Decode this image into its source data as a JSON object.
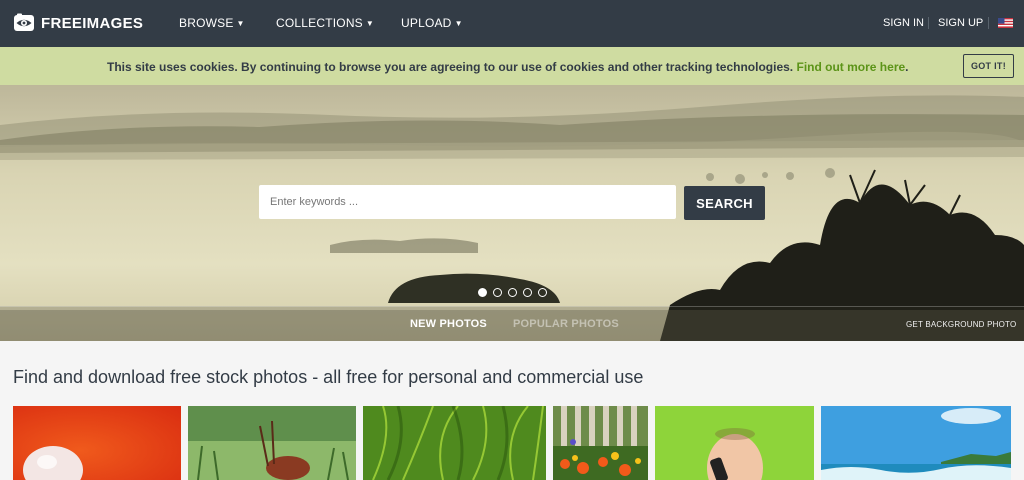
{
  "header": {
    "logo_text": "FREEIMAGES",
    "logo_icon": "eye-camera-icon",
    "nav": [
      {
        "label": "BROWSE",
        "has_dropdown": true
      },
      {
        "label": "COLLECTIONS",
        "has_dropdown": true
      },
      {
        "label": "UPLOAD",
        "has_dropdown": true
      }
    ],
    "sign_in": "SIGN IN",
    "sign_up": "SIGN UP",
    "language_icon": "us-flag-icon",
    "background_color": "#333c46"
  },
  "cookie_bar": {
    "message": "This site uses cookies. By continuing to browse you are agreeing to our use of cookies and other tracking technologies.",
    "link_text": "Find out more here",
    "suffix": ".",
    "button_label": "GOT IT!",
    "background_color": "#cfdca1",
    "link_color": "#5c9418"
  },
  "hero": {
    "search_placeholder": "Enter keywords ...",
    "search_value": "",
    "search_button": "SEARCH",
    "slide_count": 5,
    "active_slide": 1,
    "tabs": [
      {
        "label": "NEW PHOTOS",
        "active": true
      },
      {
        "label": "POPULAR PHOTOS",
        "active": false
      }
    ],
    "get_background_label": "GET BACKGROUND PHOTO"
  },
  "main": {
    "headline": "Find and download free stock photos - all free for personal and commercial use",
    "thumbnails": [
      {
        "subject": "egg on red background"
      },
      {
        "subject": "insect on grass"
      },
      {
        "subject": "green grass blades"
      },
      {
        "subject": "flowers by fence"
      },
      {
        "subject": "baby with phone"
      },
      {
        "subject": "beach waves"
      }
    ]
  }
}
